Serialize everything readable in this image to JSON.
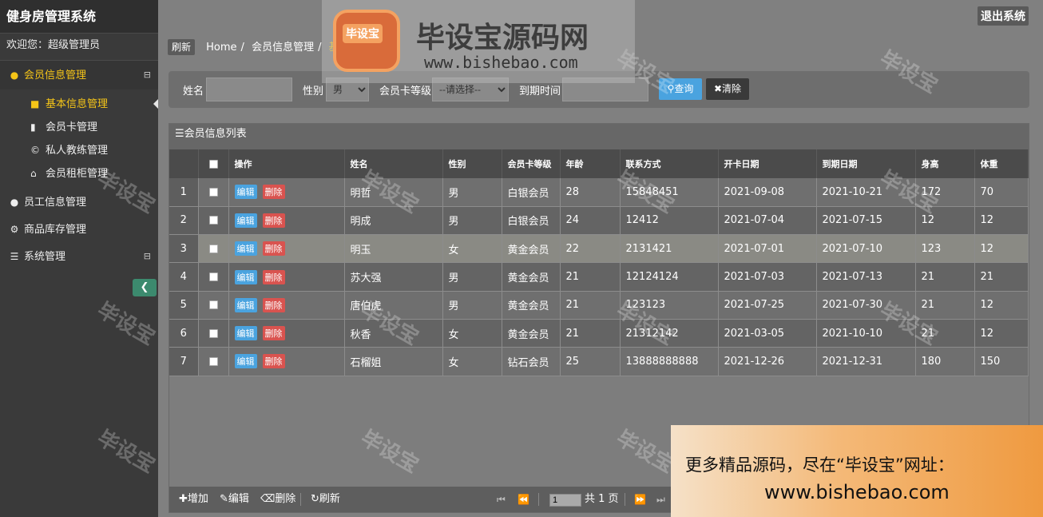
{
  "app": {
    "title": "健身房管理系统",
    "welcome": "欢迎您：超级管理员",
    "logout": "退出系统"
  },
  "sidebar": {
    "groups": [
      {
        "label": "会员信息管理",
        "icon": "user-icon",
        "collapse": "⊟"
      },
      {
        "label": "员工信息管理",
        "icon": "user-icon"
      },
      {
        "label": "商品库存管理",
        "icon": "utensils-icon"
      },
      {
        "label": "系统管理",
        "icon": "list-icon",
        "collapse": "⊟"
      }
    ],
    "sub_items": [
      {
        "label": "基本信息管理",
        "icon": "folder-icon"
      },
      {
        "label": "会员卡管理",
        "icon": "card-icon"
      },
      {
        "label": "私人教练管理",
        "icon": "copyright-icon"
      },
      {
        "label": "会员租柜管理",
        "icon": "home-icon"
      }
    ]
  },
  "breadcrumb": {
    "refresh": "刷新",
    "home": "Home",
    "level1": "会员信息管理",
    "current": "基本信息管理"
  },
  "search": {
    "name_label": "姓名",
    "name_value": "",
    "gender_label": "性别",
    "gender_value": "男",
    "card_label": "会员卡等级",
    "card_value": "--请选择--",
    "expire_label": "到期时间",
    "expire_value": "",
    "query": "查询",
    "clear": "清除"
  },
  "table": {
    "title": "会员信息列表",
    "headers": [
      "操作",
      "姓名",
      "性别",
      "会员卡等级",
      "年龄",
      "联系方式",
      "开卡日期",
      "到期日期",
      "身高",
      "体重"
    ],
    "edit": "编辑",
    "delete": "删除",
    "rows": [
      {
        "idx": "1",
        "name": "明哲",
        "gender": "男",
        "card": "白银会员",
        "age": "28",
        "phone": "15848451",
        "start": "2021-09-08",
        "end": "2021-10-21",
        "height": "172",
        "weight": "70"
      },
      {
        "idx": "2",
        "name": "明成",
        "gender": "男",
        "card": "白银会员",
        "age": "24",
        "phone": "12412",
        "start": "2021-07-04",
        "end": "2021-07-15",
        "height": "12",
        "weight": "12"
      },
      {
        "idx": "3",
        "name": "明玉",
        "gender": "女",
        "card": "黄金会员",
        "age": "22",
        "phone": "2131421",
        "start": "2021-07-01",
        "end": "2021-07-10",
        "height": "123",
        "weight": "12"
      },
      {
        "idx": "4",
        "name": "苏大强",
        "gender": "男",
        "card": "黄金会员",
        "age": "21",
        "phone": "12124124",
        "start": "2021-07-03",
        "end": "2021-07-13",
        "height": "21",
        "weight": "21"
      },
      {
        "idx": "5",
        "name": "唐伯虎",
        "gender": "男",
        "card": "黄金会员",
        "age": "21",
        "phone": "123123",
        "start": "2021-07-25",
        "end": "2021-07-30",
        "height": "21",
        "weight": "12"
      },
      {
        "idx": "6",
        "name": "秋香",
        "gender": "女",
        "card": "黄金会员",
        "age": "21",
        "phone": "21312142",
        "start": "2021-03-05",
        "end": "2021-10-10",
        "height": "21",
        "weight": "12"
      },
      {
        "idx": "7",
        "name": "石榴姐",
        "gender": "女",
        "card": "钻石会员",
        "age": "25",
        "phone": "13888888888",
        "start": "2021-12-26",
        "end": "2021-12-31",
        "height": "180",
        "weight": "150"
      }
    ]
  },
  "toolbar": {
    "add": "增加",
    "edit": "编辑",
    "delete": "删除",
    "refresh": "刷新",
    "page": "1",
    "total": "共 1 页"
  },
  "watermark": {
    "text": "毕设宝",
    "brand": "毕设宝源码网",
    "badge": "毕设宝",
    "url": "www.bishebao.com"
  },
  "ad": {
    "line1": "更多精品源码，尽在“毕设宝”网址：",
    "line2": "www.bishebao.com"
  }
}
